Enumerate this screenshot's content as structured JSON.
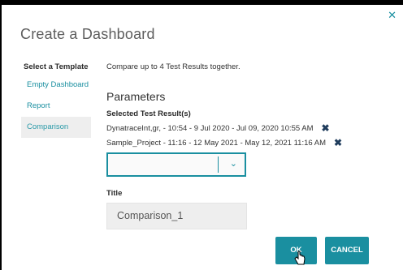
{
  "dialog": {
    "title": "Create a Dashboard",
    "close_icon": "close-icon",
    "sidebar": {
      "heading": "Select a Template",
      "items": [
        {
          "label": "Empty Dashboard",
          "active": false
        },
        {
          "label": "Report",
          "active": false
        },
        {
          "label": "Comparison",
          "active": true
        }
      ]
    },
    "description": "Compare up to 4 Test Results together.",
    "parameters_title": "Parameters",
    "selected_results_label": "Selected Test Result(s)",
    "selected_results": [
      {
        "text": "DynatraceInt,gr, - 10:54 - 9 Jul 2020 - Jul 09, 2020 10:55 AM"
      },
      {
        "text": "Sample_Project - 11:16 - 12 May 2021 - May 12, 2021 11:16 AM"
      }
    ],
    "select_value": "",
    "title_label": "Title",
    "title_value": "Comparison_1",
    "ok_label": "OK",
    "cancel_label": "CANCEL",
    "accent_color": "#1a8fa0"
  }
}
